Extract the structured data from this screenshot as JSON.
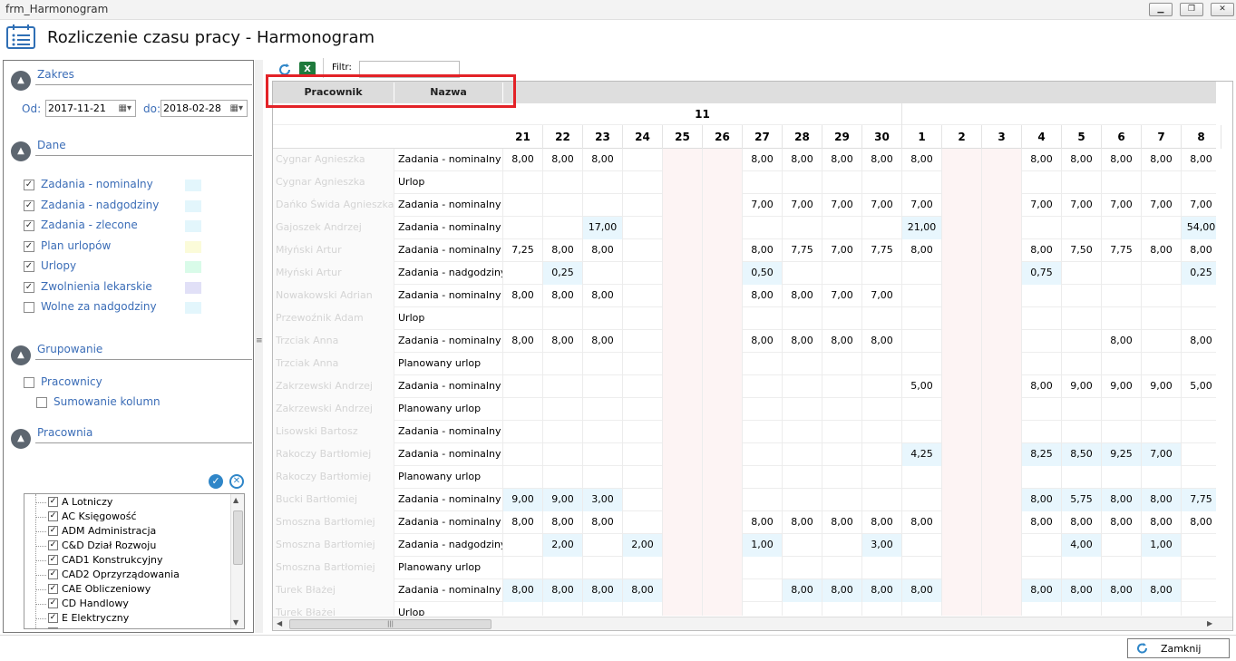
{
  "window": {
    "title": "frm_Harmonogram",
    "minimize": "▁",
    "restore": "❐",
    "close": "✕"
  },
  "header": {
    "title": "Rozliczenie czasu pracy - Harmonogram",
    "icon": "calendar-list-icon"
  },
  "left": {
    "zakres": {
      "title": "Zakres",
      "from_label": "Od:",
      "from_value": "2017-11-21",
      "to_label": "do:",
      "to_value": "2018-02-28"
    },
    "dane": {
      "title": "Dane",
      "items": [
        {
          "label": "Zadania - nominalny",
          "checked": true,
          "color": "#e3f6fc"
        },
        {
          "label": "Zadania - nadgodziny",
          "checked": true,
          "color": "#e3f6fc"
        },
        {
          "label": "Zadania - zlecone",
          "checked": true,
          "color": "#e3f6fc"
        },
        {
          "label": "Plan urlopów",
          "checked": true,
          "color": "#fbfbd9"
        },
        {
          "label": "Urlopy",
          "checked": true,
          "color": "#d9fbe9"
        },
        {
          "label": "Zwolnienia lekarskie",
          "checked": true,
          "color": "#e1e0f7"
        },
        {
          "label": "Wolne za nadgodziny",
          "checked": false,
          "color": "#e3f6fc"
        }
      ]
    },
    "grupowanie": {
      "title": "Grupowanie",
      "pracownicy": "Pracownicy",
      "sumowanie": "Sumowanie kolumn"
    },
    "pracownia": {
      "title": "Pracownia",
      "items": [
        "A Lotniczy",
        "AC Księgowość",
        "ADM Administracja",
        "C&D Dział Rozwoju",
        "CAD1 Konstrukcyjny",
        "CAD2 Oprzyrządowania",
        "CAE Obliczeniowy",
        "CD Handlowy",
        "E Elektryczny",
        "IT IT"
      ]
    }
  },
  "toolbar": {
    "filter_label": "Filtr:",
    "filter_value": ""
  },
  "grid": {
    "columns": [
      "Pracownik",
      "Nazwa"
    ],
    "month": "11",
    "days": [
      "21",
      "22",
      "23",
      "24",
      "25",
      "26",
      "27",
      "28",
      "29",
      "30",
      "1",
      "2",
      "3",
      "4",
      "5",
      "6",
      "7",
      "8"
    ],
    "rows": [
      {
        "emp": "Cygnar Agnieszka",
        "name": "Zadania - nominalny",
        "vals": [
          "8,00",
          "8,00",
          "8,00",
          "",
          "",
          "",
          "8,00",
          "8,00",
          "8,00",
          "8,00",
          "8,00",
          "",
          "",
          "8,00",
          "8,00",
          "8,00",
          "8,00",
          "8,00"
        ]
      },
      {
        "emp": "Cygnar Agnieszka",
        "name": "Urlop",
        "vals": [
          "",
          "",
          "",
          "",
          "",
          "",
          "",
          "",
          "",
          "",
          "",
          "",
          "",
          "",
          "",
          "",
          "",
          ""
        ]
      },
      {
        "emp": "Dańko Świda Agnieszka",
        "name": "Zadania - nominalny",
        "vals": [
          "",
          "",
          "",
          "",
          "",
          "",
          "7,00",
          "7,00",
          "7,00",
          "7,00",
          "7,00",
          "",
          "",
          "7,00",
          "7,00",
          "7,00",
          "7,00",
          "7,00"
        ]
      },
      {
        "emp": "Gajoszek Andrzej",
        "name": "Zadania - nominalny",
        "vals": [
          "",
          "",
          "17,00",
          "",
          "",
          "",
          "",
          "",
          "",
          "",
          "21,00",
          "",
          "",
          "",
          "",
          "",
          "",
          "54,00"
        ]
      },
      {
        "emp": "Młyński Artur",
        "name": "Zadania - nominalny",
        "vals": [
          "7,25",
          "8,00",
          "8,00",
          "",
          "",
          "",
          "8,00",
          "7,75",
          "7,00",
          "7,75",
          "8,00",
          "",
          "",
          "8,00",
          "7,50",
          "7,75",
          "8,00",
          "8,00"
        ]
      },
      {
        "emp": "Młyński Artur",
        "name": "Zadania - nadgodziny",
        "vals": [
          "",
          "0,25",
          "",
          "",
          "",
          "",
          "0,50",
          "",
          "",
          "",
          "",
          "",
          "",
          "0,75",
          "",
          "",
          "",
          "0,25"
        ]
      },
      {
        "emp": "Nowakowski Adrian",
        "name": "Zadania - nominalny",
        "vals": [
          "8,00",
          "8,00",
          "8,00",
          "",
          "",
          "",
          "8,00",
          "8,00",
          "7,00",
          "7,00",
          "",
          "",
          "",
          "",
          "",
          "",
          "",
          ""
        ]
      },
      {
        "emp": "Przewoźnik Adam",
        "name": "Urlop",
        "vals": [
          "",
          "",
          "",
          "",
          "",
          "",
          "",
          "",
          "",
          "",
          "",
          "",
          "",
          "",
          "",
          "",
          "",
          ""
        ]
      },
      {
        "emp": "Trzciak Anna",
        "name": "Zadania - nominalny",
        "vals": [
          "8,00",
          "8,00",
          "8,00",
          "",
          "",
          "",
          "8,00",
          "8,00",
          "8,00",
          "8,00",
          "",
          "",
          "",
          "",
          "",
          "8,00",
          "",
          "8,00"
        ]
      },
      {
        "emp": "Trzciak Anna",
        "name": "Planowany urlop",
        "vals": [
          "",
          "",
          "",
          "",
          "",
          "",
          "",
          "",
          "",
          "",
          "",
          "",
          "",
          "",
          "",
          "",
          "",
          ""
        ]
      },
      {
        "emp": "Zakrzewski Andrzej",
        "name": "Zadania - nominalny",
        "vals": [
          "",
          "",
          "",
          "",
          "",
          "",
          "",
          "",
          "",
          "",
          "5,00",
          "",
          "",
          "8,00",
          "9,00",
          "9,00",
          "9,00",
          "5,00"
        ]
      },
      {
        "emp": "Zakrzewski Andrzej",
        "name": "Planowany urlop",
        "vals": [
          "",
          "",
          "",
          "",
          "",
          "",
          "",
          "",
          "",
          "",
          "",
          "",
          "",
          "",
          "",
          "",
          "",
          ""
        ]
      },
      {
        "emp": "Lisowski Bartosz",
        "name": "Zadania - nominalny",
        "vals": [
          "",
          "",
          "",
          "",
          "",
          "",
          "",
          "",
          "",
          "",
          "",
          "",
          "",
          "",
          "",
          "",
          "",
          ""
        ]
      },
      {
        "emp": "Rakoczy Bartłomiej",
        "name": "Zadania - nominalny",
        "vals": [
          "",
          "",
          "",
          "",
          "",
          "",
          "",
          "",
          "",
          "",
          "4,25",
          "",
          "",
          "8,25",
          "8,50",
          "9,25",
          "7,00",
          ""
        ]
      },
      {
        "emp": "Rakoczy Bartłomiej",
        "name": "Planowany urlop",
        "vals": [
          "",
          "",
          "",
          "",
          "",
          "",
          "",
          "",
          "",
          "",
          "",
          "",
          "",
          "",
          "",
          "",
          "",
          ""
        ]
      },
      {
        "emp": "Bucki Bartłomiej",
        "name": "Zadania - nominalny",
        "vals": [
          "9,00",
          "9,00",
          "3,00",
          "",
          "",
          "",
          "",
          "",
          "",
          "",
          "",
          "",
          "",
          "8,00",
          "5,75",
          "8,00",
          "8,00",
          "7,75"
        ]
      },
      {
        "emp": "Smoszna Bartłomiej",
        "name": "Zadania - nominalny",
        "vals": [
          "8,00",
          "8,00",
          "8,00",
          "",
          "",
          "",
          "8,00",
          "8,00",
          "8,00",
          "8,00",
          "8,00",
          "",
          "",
          "8,00",
          "8,00",
          "8,00",
          "8,00",
          "8,00"
        ]
      },
      {
        "emp": "Smoszna Bartłomiej",
        "name": "Zadania - nadgodziny",
        "vals": [
          "",
          "2,00",
          "",
          "2,00",
          "",
          "",
          "1,00",
          "",
          "",
          "3,00",
          "",
          "",
          "",
          "",
          "4,00",
          "",
          "1,00",
          ""
        ]
      },
      {
        "emp": "Smoszna Bartłomiej",
        "name": "Planowany urlop",
        "vals": [
          "",
          "",
          "",
          "",
          "",
          "",
          "",
          "",
          "",
          "",
          "",
          "",
          "",
          "",
          "",
          "",
          "",
          ""
        ]
      },
      {
        "emp": "Turek Błażej",
        "name": "Zadania - nominalny",
        "vals": [
          "8,00",
          "8,00",
          "8,00",
          "8,00",
          "",
          "",
          "",
          "8,00",
          "8,00",
          "8,00",
          "8,00",
          "",
          "",
          "8,00",
          "8,00",
          "8,00",
          "8,00",
          ""
        ]
      },
      {
        "emp": "Turek Błażej",
        "name": "Urlop",
        "vals": [
          "",
          "",
          "",
          "",
          "",
          "",
          "",
          "",
          "",
          "",
          "",
          "",
          "",
          "",
          "",
          "",
          "",
          ""
        ]
      }
    ]
  },
  "footer": {
    "close_label": "Zamknij"
  }
}
